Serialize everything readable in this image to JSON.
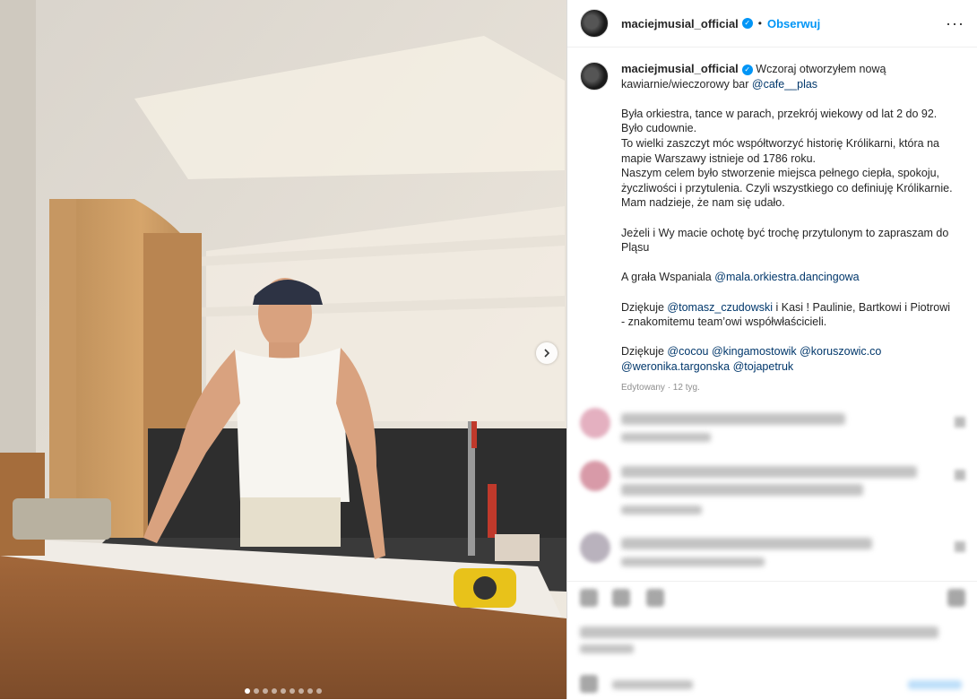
{
  "post": {
    "username": "maciejmusial_official",
    "verified_mark": "✓",
    "separator": "•",
    "follow_label": "Obserwuj",
    "more_label": "···"
  },
  "caption": {
    "username": "maciejmusial_official",
    "line1": "Wczoraj otworzyłem nową kawiarnie/wieczorowy bar",
    "mention_cafe": "@cafe__plas",
    "p1_l1": "Była orkiestra, tance w parach, przekrój wiekowy od lat 2 do 92.",
    "p1_l2": "Było cudownie.",
    "p1_l3": "To wielki zaszczyt móc współtworzyć historię Królikarni, która na mapie Warszawy istnieje od 1786 roku.",
    "p1_l4": "Naszym celem było stworzenie miejsca pełnego ciepła, spokoju, życzliwości i przytulenia. Czyli wszystkiego co definiuję Królikarnie. Mam nadzieje, że nam się udało.",
    "p2": "Jeżeli i Wy macie ochotę być trochę przytulonym to zapraszam do Pląsu",
    "p3_prefix": "A grała Wspaniala",
    "mention_orkiestra": "@mala.orkiestra.dancingowa",
    "p4_prefix": "Dziękuje",
    "mention_tomasz": "@tomasz_czudowski",
    "p4_rest": "i Kasi ! Paulinie, Bartkowi i Piotrowi - znakomitemu team’owi współwłaścicieli.",
    "p5_prefix": "Dziękuje",
    "mention_cocou": "@cocou",
    "mention_kinga": "@kingamostowik",
    "mention_koruszowic": "@koruszowic.co",
    "mention_weronika": "@weronika.targonska",
    "mention_tojapetruk": "@tojapetruk",
    "meta": "Edytowany · 12 tyg."
  },
  "carousel": {
    "slide_count": 9,
    "active_index": 0
  }
}
